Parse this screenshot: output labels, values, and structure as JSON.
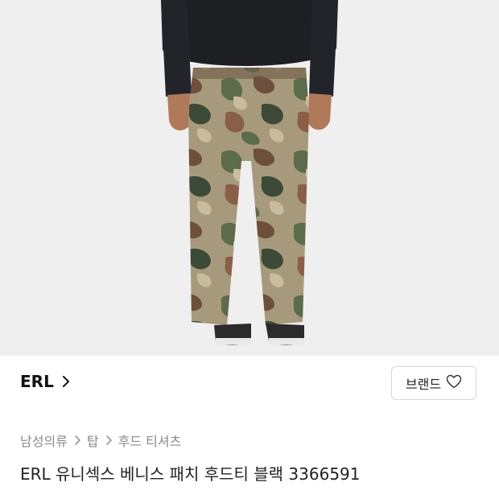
{
  "product_image": {
    "icon": "product-photo",
    "subject": "model-wearing-camo-pants"
  },
  "brand": {
    "name": "ERL",
    "chevron_icon": "chevron-right-icon"
  },
  "brand_button": {
    "label": "브랜드",
    "icon": "heart-outline-icon"
  },
  "breadcrumb": {
    "items": [
      "남성의류",
      "탑",
      "후드 티셔츠"
    ],
    "separator_icon": "chevron-right-icon"
  },
  "product_title": "ERL 유니섹스 베니스 패치 후드티 블랙 3366591",
  "colors": {
    "text_primary": "#111111",
    "text_secondary": "#8a8a8a",
    "border": "#d6d6d6",
    "photo_bg": "#efefef"
  }
}
